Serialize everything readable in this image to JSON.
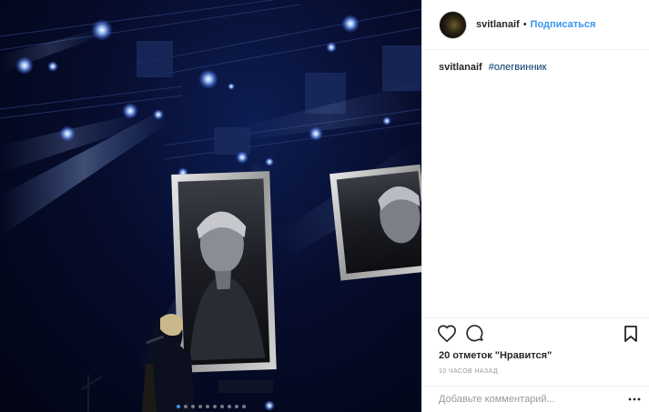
{
  "post": {
    "username": "svitlanaif",
    "separator": "•",
    "follow_label": "Подписаться",
    "caption": {
      "username": "svitlanaif",
      "hashtag": "#олегвинник"
    },
    "likes_text": "20 отметок \"Нравится\"",
    "time_ago": "10 часов назад",
    "comment_placeholder": "Добавьте комментарий...",
    "carousel": {
      "total": 10,
      "active_index": 0
    }
  },
  "colors": {
    "accent": "#3897f0",
    "hashtag": "#003569",
    "muted": "#999999",
    "text": "#262626",
    "border": "#efefef"
  },
  "icons": {
    "like": "heart-icon",
    "comment": "speech-bubble-icon",
    "save": "bookmark-icon",
    "more": "ellipsis-icon"
  }
}
